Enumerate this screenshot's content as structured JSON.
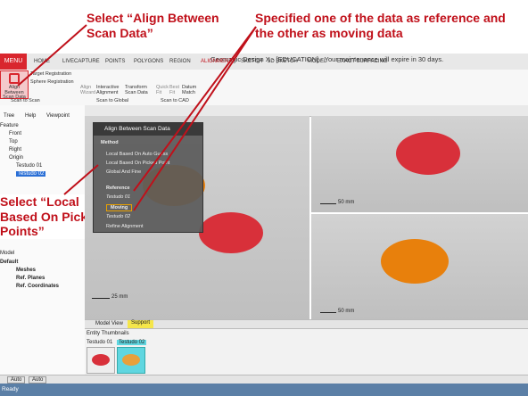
{
  "annotations": {
    "align_between": "Select “Align Between Scan Data”",
    "reference_moving": "Specified one of the data as reference and the other as moving data",
    "local_based": "Select “Local Based On Picked Points”"
  },
  "window": {
    "title": "Geomagic Design X - [EDUCATION] - Your maintenance will expire in 30 days."
  },
  "ribbon": {
    "menu": "MENU",
    "tabs": [
      "HOME",
      "LIVECAPTURE",
      "POINTS",
      "POLYGONS",
      "REGION",
      "ALIGNMENT",
      "SKETCH",
      "3D SKETCH",
      "MODEL",
      "EXACT SURFACING"
    ],
    "align_between": "Align Between Scan Data",
    "target_registration": "Target Registration",
    "sphere_registration": "Sphere Registration",
    "align_wizard": "Align Wizard",
    "interactive_alignment": "Interactive Alignment",
    "transform_scan_data": "Transform Scan Data",
    "quick_fit": "Quick Fit",
    "best_fit": "Best Fit",
    "datum_match": "Datum Match",
    "group_scan_to_scan": "Scan to Scan",
    "group_scan_to_global": "Scan to Global",
    "group_scan_to_cad": "Scan to CAD"
  },
  "tree": {
    "tabs": [
      "Tree",
      "Help",
      "Viewpoint"
    ],
    "items": [
      "Feature",
      "Front",
      "Top",
      "Right",
      "Origin",
      "Testudo 01",
      "Testudo 02"
    ],
    "model_header": "Model",
    "model_items": [
      "Default",
      "Meshes",
      "Ref. Planes",
      "Ref. Coordinates"
    ]
  },
  "dialog": {
    "title": "Align Between Scan Data",
    "method_label": "Method",
    "options": [
      "Local Based On Auto Guess",
      "Local Based On Picked Point",
      "Global And Fine"
    ],
    "reference_label": "Reference",
    "reference_value": "Testudo 01",
    "moving_label": "Moving",
    "moving_value": "Testudo 02",
    "refine": "Refine Alignment"
  },
  "viewport": {
    "scale_main": "25 mm",
    "scale_top": "50 mm",
    "scale_bottom": "50 mm",
    "tabs": [
      "Model View",
      "Support"
    ]
  },
  "thumbnails": {
    "header": "Entity Thumbnails",
    "items": [
      "Testudo 01",
      "Testudo 02"
    ]
  },
  "bottom": {
    "combo1": "Auto",
    "combo2": "Auto"
  },
  "status": "Ready",
  "colors": {
    "annotation": "#c0101a",
    "reference_turtle": "#d8303a",
    "moving_turtle": "#e8800c",
    "ribbon_accent": "#d9262e"
  }
}
